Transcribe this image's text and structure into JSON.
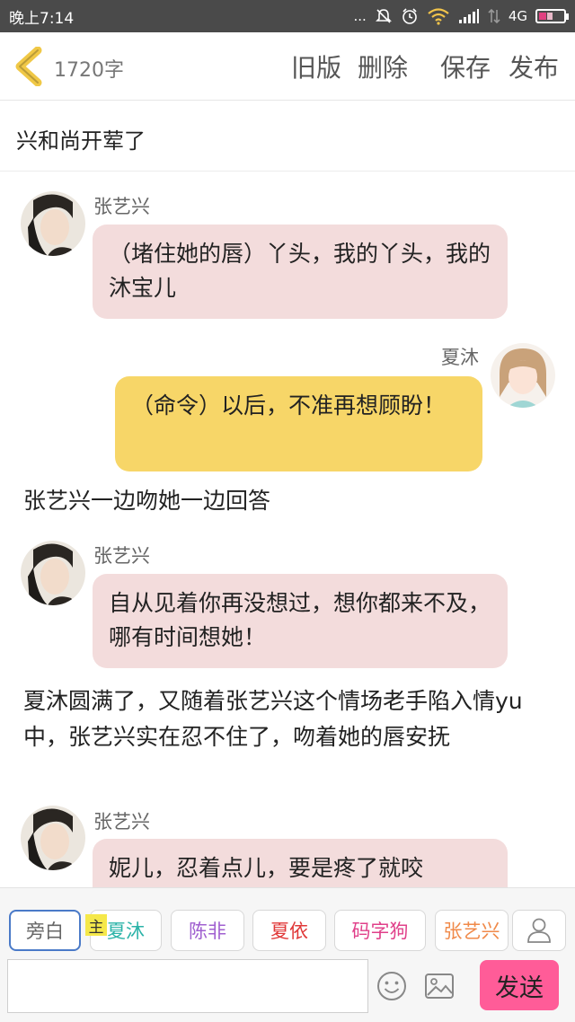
{
  "status_bar": {
    "time": "晚上7:14",
    "dots": "...",
    "network": "4G"
  },
  "header": {
    "word_count": "1720字",
    "old_version": "旧版",
    "delete": "删除",
    "save": "保存",
    "publish": "发布"
  },
  "story": {
    "title": "兴和尚开荤了"
  },
  "messages": [
    {
      "speaker": "张艺兴",
      "text": "（堵住她的唇）丫头，我的丫头，我的沐宝儿"
    },
    {
      "speaker": "夏沐",
      "text": "（命令）以后，不准再想顾盼！"
    },
    {
      "narration": "张艺兴一边吻她一边回答"
    },
    {
      "speaker": "张艺兴",
      "text": "自从见着你再没想过，想你都来不及，哪有时间想她！"
    },
    {
      "narration": "夏沐圆满了，又随着张艺兴这个情场老手陷入情yu中，张艺兴实在忍不住了，吻着她的唇安抚"
    },
    {
      "speaker": "张艺兴",
      "text": "妮儿，忍着点儿，要是疼了就咬"
    }
  ],
  "roles": [
    {
      "label": "旁白",
      "color": "#666666"
    },
    {
      "label": "夏沐",
      "color": "#2bb3a8"
    },
    {
      "label": "陈非",
      "color": "#a060d0"
    },
    {
      "label": "夏依",
      "color": "#e03838"
    },
    {
      "label": "码字狗",
      "color": "#e0408a"
    },
    {
      "label": "张艺兴",
      "color": "#f08a4a"
    }
  ],
  "main_tag": "主",
  "input": {
    "value": "",
    "send": "发送"
  },
  "icons": [
    "back-chevron-icon",
    "emoji-icon",
    "image-icon",
    "user-icon",
    "mute-icon",
    "alarm-icon",
    "wifi-icon",
    "signal-icon",
    "battery-icon"
  ]
}
